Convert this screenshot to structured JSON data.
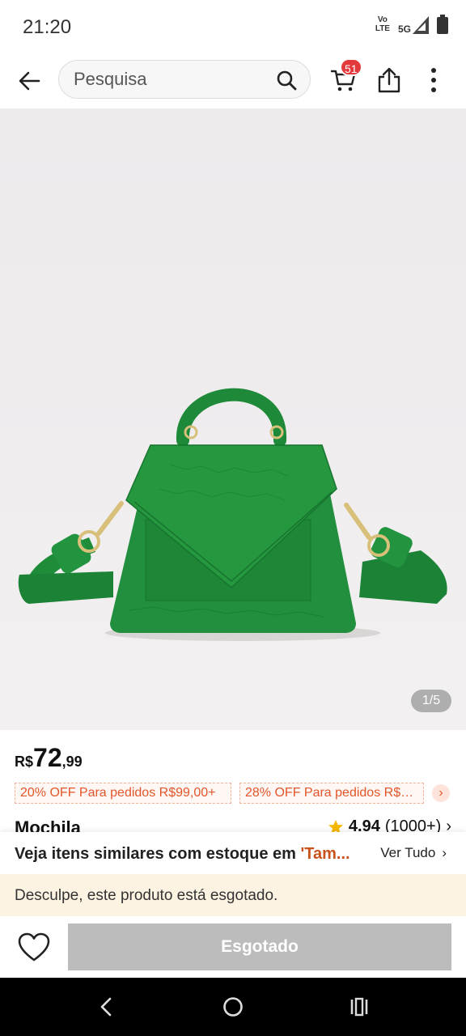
{
  "status_bar": {
    "time": "21:20",
    "volte_line1": "Vo",
    "volte_line2": "LTE",
    "network": "5G"
  },
  "nav": {
    "search_placeholder": "Pesquisa",
    "cart_count": "51"
  },
  "product": {
    "image_counter": "1/5",
    "price_currency": "R$",
    "price_integer": "72",
    "price_cents": ",99",
    "coupons": [
      "20% OFF Para pedidos R$99,00+",
      "28% OFF Para pedidos R$1..."
    ],
    "coupon_arrow": "›",
    "title": "Mochila",
    "rating_score": "4.94",
    "rating_count": "(1000+)",
    "rating_arrow": "›"
  },
  "similar": {
    "text": "Veja itens similares com estoque em ",
    "highlight": "'Tam...",
    "see_all": "Ver Tudo",
    "see_all_arrow": "›"
  },
  "soldout": {
    "message": "Desculpe, este produto está esgotado.",
    "button_label": "Esgotado"
  },
  "colors": {
    "accent_red": "#e4393c",
    "coupon_orange": "#e2562b",
    "banner_bg": "#fdf3e3",
    "disabled_button": "#bcbcbc",
    "bag_green": "#1f8c3a"
  },
  "icons": {
    "back": "back-arrow-icon",
    "search": "search-icon",
    "cart": "cart-icon",
    "share": "share-icon",
    "more": "more-vertical-icon",
    "star": "star-icon",
    "heart": "heart-icon"
  }
}
